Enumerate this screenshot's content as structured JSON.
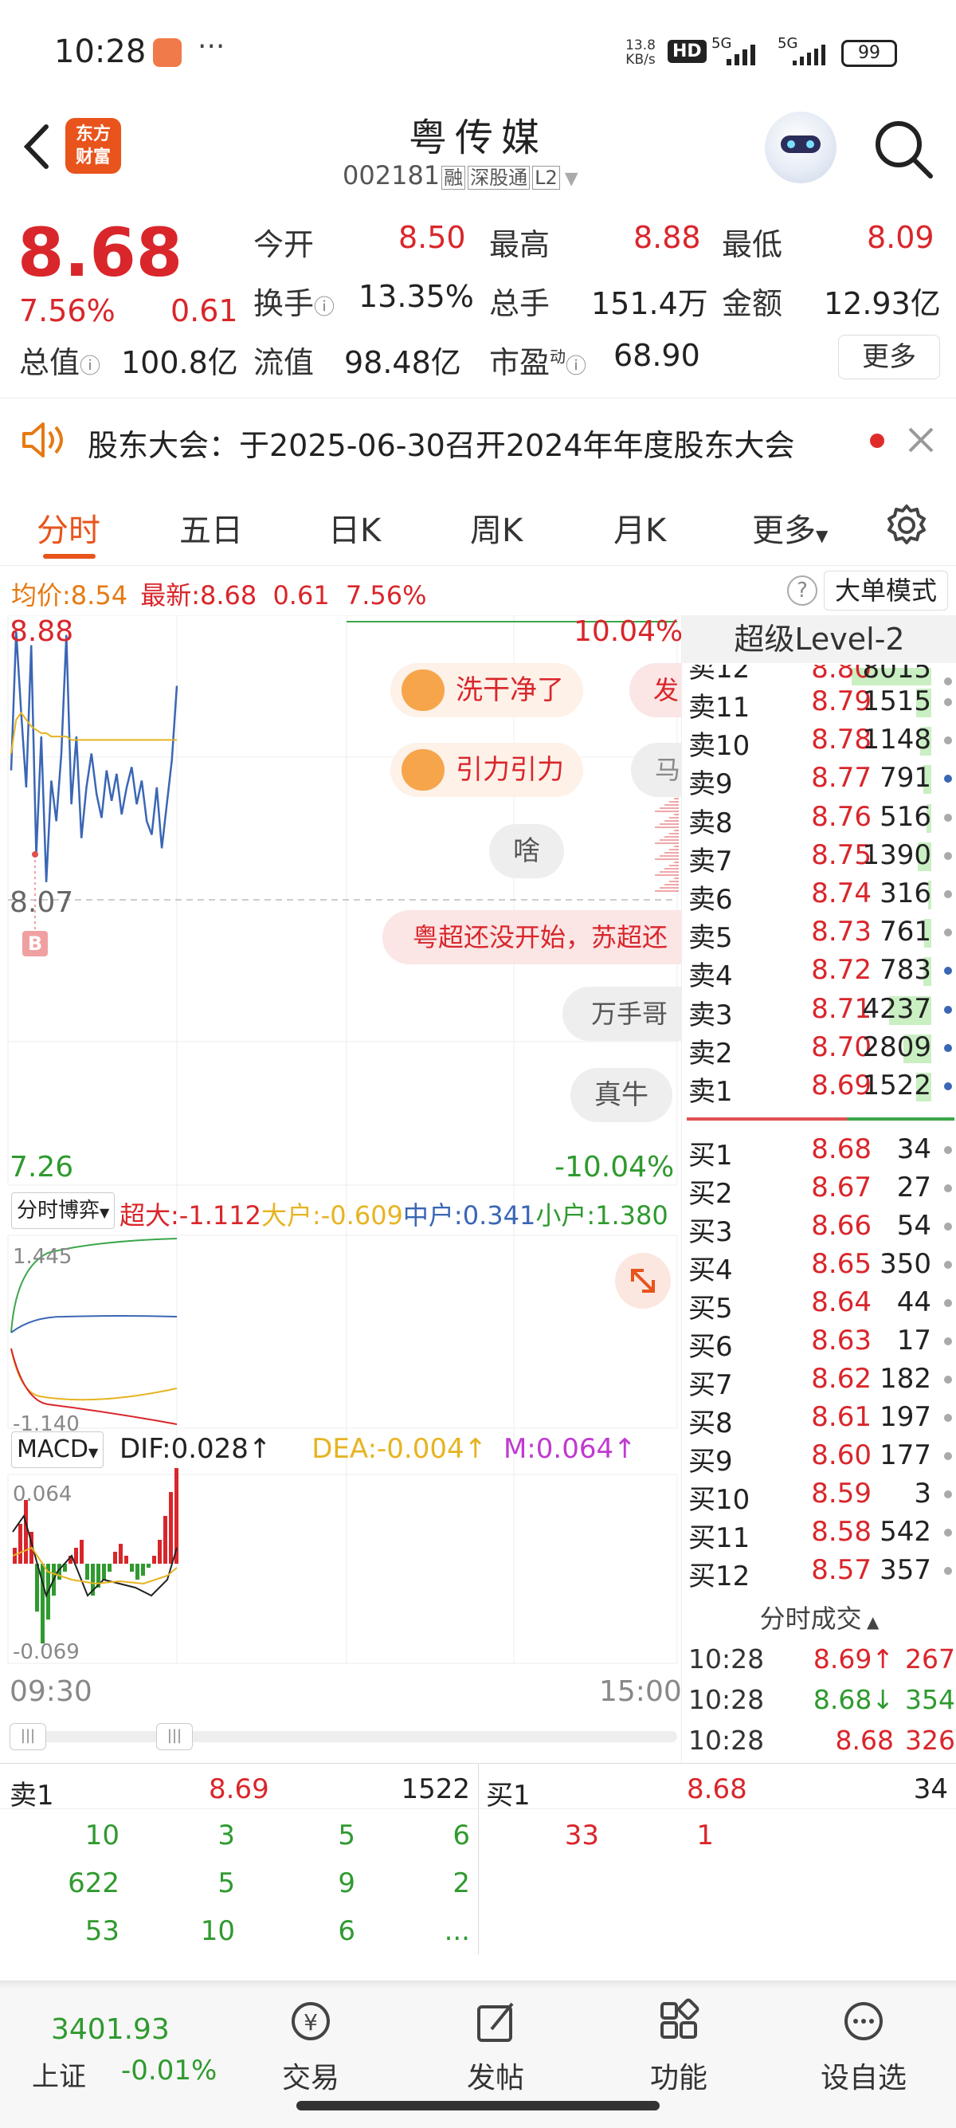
{
  "status_bar": {
    "time": "10:28",
    "net_speed_top": "13.8",
    "net_speed_unit": "KB/s",
    "hd_label": "HD",
    "sig1": "5G",
    "sig2": "5G",
    "battery": "99"
  },
  "header": {
    "brand_line1": "东方",
    "brand_line2": "财富",
    "stock_name": "粤传媒",
    "code": "002181",
    "tag_rong": "融",
    "tag_exchange": "深股通",
    "tag_level": "L2"
  },
  "quote": {
    "price": "8.68",
    "change_pct": "7.56%",
    "change": "0.61",
    "open_label": "今开",
    "open": "8.50",
    "high_label": "最高",
    "high": "8.88",
    "low_label": "最低",
    "low": "8.09",
    "turnover_label": "换手",
    "turnover": "13.35%",
    "volume_label": "总手",
    "volume": "151.4万",
    "amount_label": "金额",
    "amount": "12.93亿",
    "mktcap_label": "总值",
    "mktcap": "100.8亿",
    "float_label": "流值",
    "float": "98.48亿",
    "pe_label": "市盈",
    "pe_sup": "动",
    "pe": "68.90",
    "more": "更多"
  },
  "notice": {
    "text": "股东大会：于2025-06-30召开2024年年度股东大会"
  },
  "tabs": [
    "分时",
    "五日",
    "日K",
    "周K",
    "月K",
    "更多"
  ],
  "info_bar": {
    "avg_label": "均价:",
    "avg": "8.54",
    "latest_label": "最新:",
    "latest": "8.68",
    "change": "0.61",
    "change_pct": "7.56%",
    "big_order_mode": "大单模式"
  },
  "chart_data": {
    "type": "line",
    "title": "",
    "price_max": "8.88",
    "price_mid": "8.07",
    "price_min": "7.26",
    "pct_max": "10.04%",
    "pct_min": "-10.04%",
    "marker": "B",
    "time_start": "09:30",
    "time_end": "15:00",
    "ylim": [
      7.26,
      8.88
    ],
    "price_series": [
      8.45,
      8.86,
      8.62,
      8.4,
      8.82,
      8.2,
      8.55,
      8.12,
      8.42,
      8.3,
      8.5,
      8.85,
      8.35,
      8.55,
      8.25,
      8.4,
      8.5,
      8.38,
      8.31,
      8.45,
      8.36,
      8.44,
      8.32,
      8.4,
      8.46,
      8.35,
      8.42,
      8.3,
      8.26,
      8.4,
      8.22,
      8.35,
      8.48,
      8.7
    ],
    "avg_series": [
      8.5,
      8.6,
      8.62,
      8.6,
      8.58,
      8.57,
      8.56,
      8.56,
      8.55,
      8.55,
      8.55,
      8.55,
      8.54,
      8.54,
      8.54,
      8.54,
      8.54,
      8.54,
      8.54,
      8.54,
      8.54,
      8.54,
      8.54,
      8.54,
      8.54,
      8.54,
      8.54,
      8.54,
      8.54,
      8.54,
      8.54,
      8.54,
      8.54,
      8.54
    ],
    "flow": {
      "selector": "分时博弈",
      "super_label": "超大:",
      "super": "-1.112",
      "large_label": "大户:",
      "large": "-0.609",
      "mid_label": "中户:",
      "mid": "0.341",
      "small_label": "小户:",
      "small": "1.380",
      "ymax": "1.445",
      "ymin": "-1.140"
    },
    "macd": {
      "selector": "MACD",
      "dif_label": "DIF:",
      "dif": "0.028",
      "dea_label": "DEA:",
      "dea": "-0.004",
      "m_label": "M:",
      "m": "0.064",
      "ymax": "0.064",
      "ymin": "-0.069"
    }
  },
  "comments": [
    {
      "text": "洗干净了",
      "style": "face"
    },
    {
      "text": "引力引力",
      "style": "face"
    },
    {
      "text": "啥",
      "style": "plain"
    },
    {
      "text": "粤超还没开始，苏超还",
      "style": "pink"
    },
    {
      "text": "万手哥",
      "style": "plain"
    },
    {
      "text": "真牛",
      "style": "plain"
    }
  ],
  "orderbook": {
    "title": "超级Level-2",
    "asks": [
      {
        "label": "卖12",
        "price": "8.80",
        "vol": "8015"
      },
      {
        "label": "卖11",
        "price": "8.79",
        "vol": "1515"
      },
      {
        "label": "卖10",
        "price": "8.78",
        "vol": "1148"
      },
      {
        "label": "卖9",
        "price": "8.77",
        "vol": "791"
      },
      {
        "label": "卖8",
        "price": "8.76",
        "vol": "516"
      },
      {
        "label": "卖7",
        "price": "8.75",
        "vol": "1390"
      },
      {
        "label": "卖6",
        "price": "8.74",
        "vol": "316"
      },
      {
        "label": "卖5",
        "price": "8.73",
        "vol": "761"
      },
      {
        "label": "卖4",
        "price": "8.72",
        "vol": "783"
      },
      {
        "label": "卖3",
        "price": "8.71",
        "vol": "4237"
      },
      {
        "label": "卖2",
        "price": "8.70",
        "vol": "2809"
      },
      {
        "label": "卖1",
        "price": "8.69",
        "vol": "1522"
      }
    ],
    "bids": [
      {
        "label": "买1",
        "price": "8.68",
        "vol": "34"
      },
      {
        "label": "买2",
        "price": "8.67",
        "vol": "27"
      },
      {
        "label": "买3",
        "price": "8.66",
        "vol": "54"
      },
      {
        "label": "买4",
        "price": "8.65",
        "vol": "350"
      },
      {
        "label": "买5",
        "price": "8.64",
        "vol": "44"
      },
      {
        "label": "买6",
        "price": "8.63",
        "vol": "17"
      },
      {
        "label": "买7",
        "price": "8.62",
        "vol": "182"
      },
      {
        "label": "买8",
        "price": "8.61",
        "vol": "197"
      },
      {
        "label": "买9",
        "price": "8.60",
        "vol": "177"
      },
      {
        "label": "买10",
        "price": "8.59",
        "vol": "3"
      },
      {
        "label": "买11",
        "price": "8.58",
        "vol": "542"
      },
      {
        "label": "买12",
        "price": "8.57",
        "vol": "357"
      }
    ],
    "ticks_title": "分时成交",
    "ticks": [
      {
        "time": "10:28",
        "price": "8.69↑",
        "vol": "267"
      },
      {
        "time": "10:28",
        "price": "8.68↓",
        "vol": "354"
      },
      {
        "time": "10:28",
        "price": "8.68",
        "vol": "326"
      }
    ]
  },
  "queue": {
    "ask_label": "卖1",
    "ask_price": "8.69",
    "ask_total": "1522",
    "bid_label": "买1",
    "bid_price": "8.68",
    "bid_total": "34",
    "ask_rows": [
      [
        "10",
        "3",
        "5",
        "6"
      ],
      [
        "622",
        "5",
        "9",
        "2"
      ],
      [
        "53",
        "10",
        "6",
        "..."
      ]
    ],
    "bid_rows": [
      [
        "33",
        "1"
      ]
    ]
  },
  "bottom_nav": {
    "index_value": "3401.93",
    "index_name": "上证",
    "index_change": "-0.01%",
    "items": [
      "交易",
      "发帖",
      "功能",
      "设自选"
    ]
  },
  "colors": {
    "up": "#d9262b",
    "down": "#2f9a2f",
    "accent": "#e8541c",
    "avg_line": "#e6b422",
    "price_line": "#3a66b5"
  }
}
